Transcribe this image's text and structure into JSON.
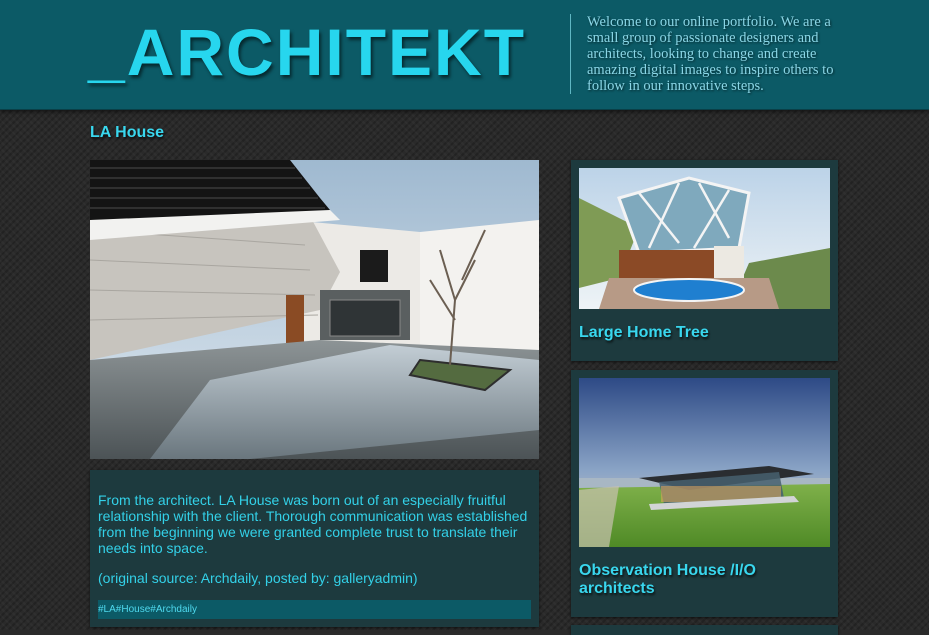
{
  "header": {
    "logo": "_ARCHITEKT",
    "tagline": "Welcome to our online portfolio. We are a small group of passionate designers and architects, looking to change and create amazing digital images to inspire others to follow in our innovative steps."
  },
  "post": {
    "title": "LA House",
    "body": "From the architect. LA House was born out of an especially fruitful relationship with the client. Thorough communication was established from the beginning we were granted complete trust to translate their needs into space.",
    "source": "(original source: Archdaily, posted by: galleryadmin)",
    "tags": [
      "#LA",
      "#House",
      "#Archdaily"
    ]
  },
  "sidebar": {
    "cards": [
      {
        "title": "Large Home Tree"
      },
      {
        "title": "Observation House /I/O architects"
      }
    ]
  },
  "colors": {
    "header_bg": "#0c5a66",
    "accent": "#27d6ee",
    "panel_bg": "#1d3a3e"
  }
}
